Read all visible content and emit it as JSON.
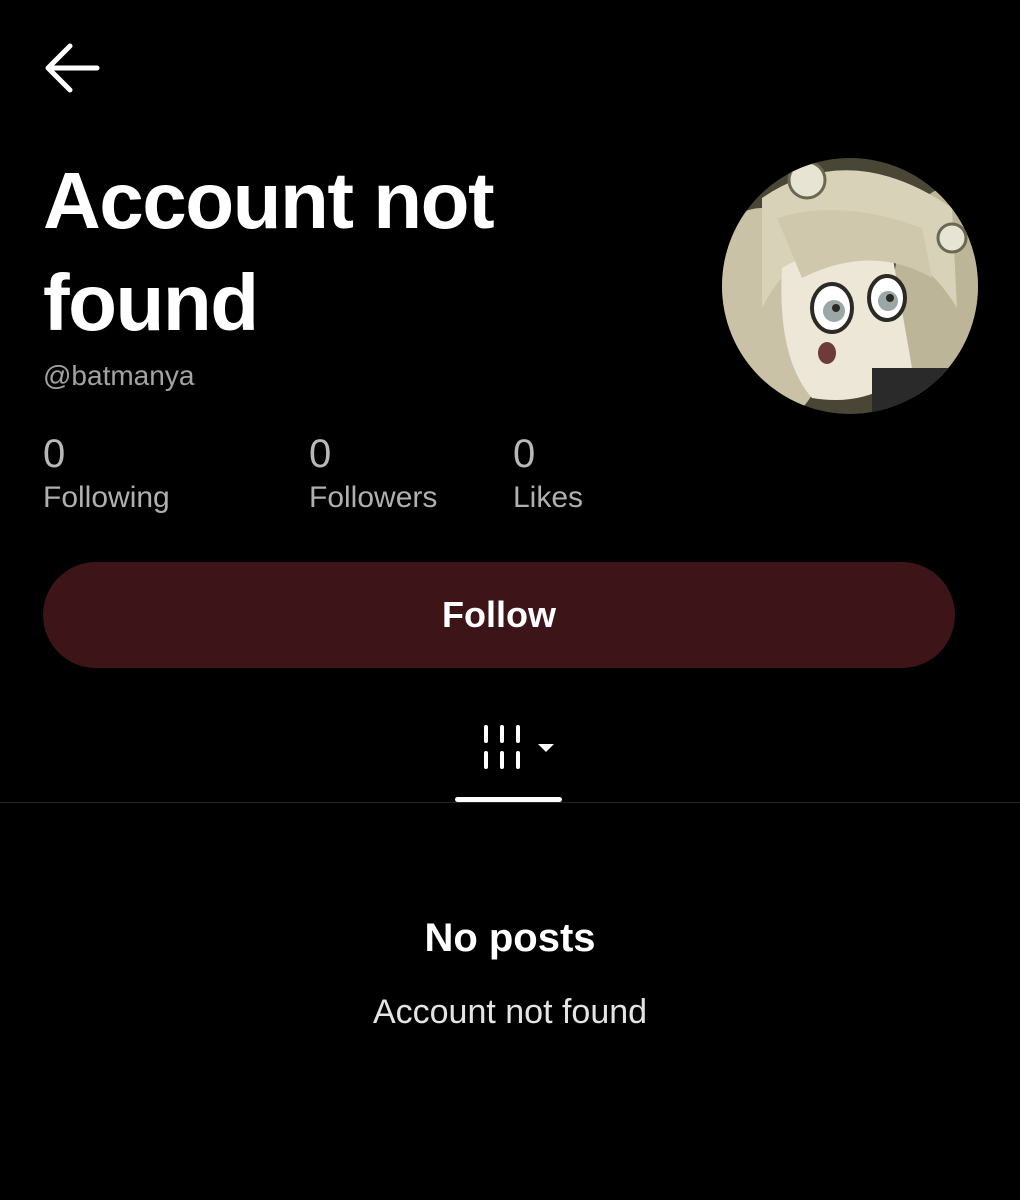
{
  "header": {
    "back_icon": "arrow-left-icon"
  },
  "profile": {
    "title": "Account not found",
    "handle": "@batmanya",
    "avatar_icon": "avatar-image"
  },
  "stats": {
    "following": {
      "value": "0",
      "label": "Following"
    },
    "followers": {
      "value": "0",
      "label": "Followers"
    },
    "likes": {
      "value": "0",
      "label": "Likes"
    }
  },
  "actions": {
    "follow_label": "Follow",
    "follow_color": "#3d1519"
  },
  "tabs": {
    "videos_icon": "grid-columns-icon",
    "dropdown_icon": "caret-down-icon"
  },
  "empty_state": {
    "title": "No posts",
    "subtitle": "Account not found"
  }
}
